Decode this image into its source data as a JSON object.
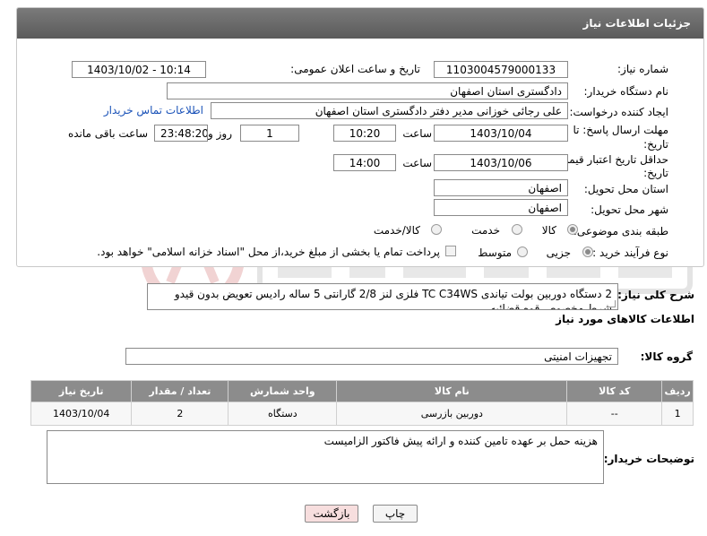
{
  "header": {
    "title": "جزئیات اطلاعات نیاز"
  },
  "fields": {
    "need_number_label": "شماره نیاز:",
    "need_number": "1103004579000133",
    "announce_label": "تاریخ و ساعت اعلان عمومی:",
    "announce_value": "1403/10/02 - 10:14",
    "buyer_org_label": "نام دستگاه خریدار:",
    "buyer_org": "دادگستری استان اصفهان",
    "requester_label": "ایجاد کننده درخواست:",
    "requester": "علی رجائی خوزانی مدیر دفتر دادگستری استان اصفهان",
    "contact_link": "اطلاعات تماس خریدار",
    "reply_deadline_label_1": "مهلت ارسال پاسخ: تا",
    "reply_deadline_label_2": "تاریخ:",
    "reply_date": "1403/10/04",
    "time_label": "ساعت",
    "reply_time": "10:20",
    "days_value": "1",
    "days_label": "روز و",
    "remaining_time": "23:48:20",
    "remaining_label": "ساعت باقی مانده",
    "validity_label_1": "حداقل تاریخ اعتبار قیمت: تا",
    "validity_label_2": "تاریخ:",
    "validity_date": "1403/10/06",
    "validity_time": "14:00",
    "province_label": "استان محل تحویل:",
    "province": "اصفهان",
    "city_label": "شهر محل تحویل:",
    "city": "اصفهان",
    "category_label": "طبقه بندی موضوعی:",
    "category_options": [
      "کالا",
      "خدمت",
      "کالا/خدمت"
    ],
    "process_label": "نوع فرآیند خرید :",
    "process_options": [
      "جزیی",
      "متوسط"
    ],
    "payment_note": "پرداخت تمام یا بخشی از مبلغ خرید،از محل \"اسناد خزانه اسلامی\" خواهد بود."
  },
  "summary": {
    "label": "شرح کلی نیاز:",
    "text": "2 دستگاه دوربین بولت تیاندی TC C34WS فلزی لنز 2/8 گارانتی 5 ساله رادیس تعویض بدون قیدو شرط مخصوص قوه قضائیه"
  },
  "goods_section": {
    "title": "اطلاعات کالاهای مورد نیاز",
    "group_label": "گروه کالا:",
    "group_value": "تجهیزات امنیتی"
  },
  "table": {
    "headers": [
      "ردیف",
      "کد کالا",
      "نام کالا",
      "واحد شمارش",
      "تعداد / مقدار",
      "تاریخ نیاز"
    ],
    "rows": [
      [
        "1",
        "--",
        "دوربین بازرسی",
        "دستگاه",
        "2",
        "1403/10/04"
      ]
    ]
  },
  "buyer_notes": {
    "label": "توضیحات خریدار:",
    "text": "هزینه حمل بر عهده تامین کننده و ارائه پیش فاکتور الزامیست"
  },
  "buttons": {
    "print": "چاپ",
    "back": "بازگشت"
  },
  "colors": {
    "header_bg": "#676767",
    "link": "#1a52b8",
    "back_bg": "#f7dede",
    "table_head": "#8c8c8c"
  }
}
